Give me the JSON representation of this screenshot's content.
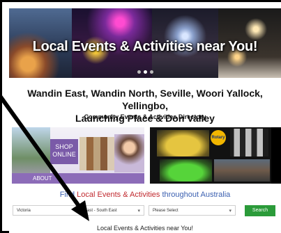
{
  "hero": {
    "title": "Local Events & Activities near You!",
    "slide_count": 3,
    "active_slide": 2
  },
  "heading": {
    "suburbs_line1": "Wandin East, Wandin North, Seville, Woori Yallock, Yellingbo,",
    "suburbs_line2": "Launching Place & Don Valley",
    "subtitle": "Community Events & Activities Directory"
  },
  "promo_left": {
    "shop_line1": "SHOP",
    "shop_line2": "ONLINE",
    "about": "ABOUT"
  },
  "promo_right": {
    "rotary": "Rotary"
  },
  "find": {
    "prefix": "Find ",
    "highlight": "Local Events & Activities",
    "suffix": " throughout Australia"
  },
  "filters": {
    "state": "Victoria",
    "region": "East - South East",
    "location": "Please Select",
    "search_label": "Search"
  },
  "footer": {
    "near_text": "Local Events & Activities near You!"
  },
  "colors": {
    "accent_blue": "#3a5fb0",
    "accent_red": "#c0282e",
    "search_green": "#2b9b3a"
  }
}
